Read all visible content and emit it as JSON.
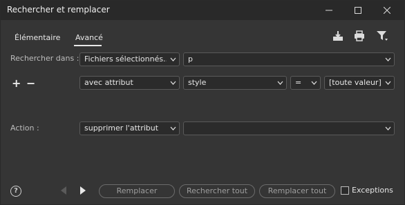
{
  "window": {
    "title": "Rechercher et remplacer"
  },
  "tabs": [
    {
      "label": "Élémentaire",
      "active": false
    },
    {
      "label": "Avancé",
      "active": true
    }
  ],
  "toolbar": {
    "icons": [
      "save-icon",
      "print-icon",
      "filter-icon"
    ]
  },
  "search_in": {
    "label": "Rechercher dans :",
    "scope_value": "Fichiers sélectionnés...",
    "tag_value": "p"
  },
  "condition": {
    "add_label": "+",
    "remove_label": "−",
    "type_value": "avec attribut",
    "attribute_value": "style",
    "operator_value": "=",
    "value_value": "[toute valeur]"
  },
  "action": {
    "label": "Action :",
    "type_value": "supprimer l'attribut",
    "value_value": ""
  },
  "footer": {
    "help_label": "?",
    "replace_label": "Remplacer",
    "find_all_label": "Rechercher tout",
    "replace_all_label": "Remplacer tout",
    "exceptions_label": "Exceptions",
    "exceptions_checked": false
  },
  "colors": {
    "background": "#353535",
    "titlebar": "#292929",
    "field_bg": "#2b2b2b",
    "field_border": "#5a5a5a"
  }
}
